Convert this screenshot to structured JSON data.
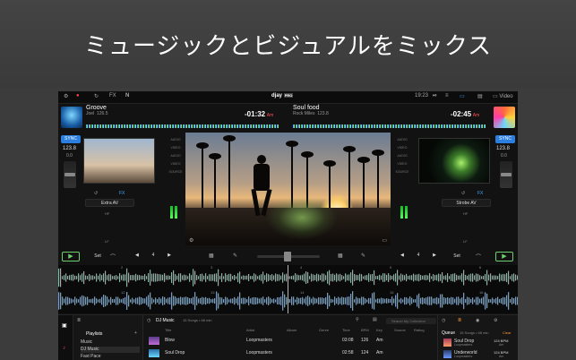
{
  "headline": "ミュージックとビジュアルをミックス",
  "topbar": {
    "fx": "FX",
    "logo": "djay",
    "pro_badge": "PRO",
    "clock": "19:23",
    "video_label": "Video"
  },
  "deck_left": {
    "title": "Groove",
    "artist": "Joel",
    "artist_bpm": "126.5",
    "time": "-01:32",
    "key": "Am",
    "sync": "SYNC",
    "bpm": "123.8",
    "pitch": "0.0",
    "effect": "Extra AV",
    "fx": "FX",
    "label_lf": "LF",
    "label_hf": "HF",
    "set": "Set",
    "beat": "4",
    "play": "▶"
  },
  "deck_right": {
    "title": "Soul food",
    "artist": "Rock Miles",
    "artist_bpm": "123.8",
    "time": "-02:45",
    "key": "Am",
    "sync": "SYNC",
    "bpm": "123.8",
    "pitch": "0.0",
    "effect": "Strobe AV",
    "fx": "FX",
    "label_lf": "LF",
    "label_hf": "HF",
    "set": "Set",
    "beat": "4",
    "play": "▶"
  },
  "mixer": {
    "labels": [
      "AUDIO",
      "VIDEO",
      "AUDIO",
      "VIDEO",
      "SOURCE"
    ]
  },
  "waveforms": {
    "markers_top": [
      "2",
      "3",
      "4",
      "5",
      "6"
    ],
    "markers_bottom": [
      "12",
      "13",
      "14",
      "15",
      "16"
    ]
  },
  "browser": {
    "playlists_title": "Playlists",
    "playlists": [
      "Music",
      "DJ Music",
      "Fast Pace"
    ],
    "active_playlist": "DJ Music",
    "list_title": "DJ Music",
    "list_meta": "15 Songs • 68 min",
    "search_placeholder": "Search My Collection",
    "columns": [
      "Title",
      "Artist",
      "Album",
      "Genre",
      "Time",
      "BPM",
      "Key",
      "Source",
      "Rating"
    ],
    "tracks": [
      {
        "title": "Blow",
        "artist": "Loopmasters",
        "time": "03:08",
        "bpm": "126",
        "key": "Am"
      },
      {
        "title": "Soul Drop",
        "artist": "Loopmasters",
        "time": "02:58",
        "bpm": "124",
        "key": "Am"
      }
    ],
    "queue_title": "Queue",
    "queue_meta": "15 Songs • 68 min",
    "queue_clear": "Clear",
    "queue": [
      {
        "title": "Soul Drop",
        "artist": "Loopmasters",
        "bpm": "124 BPM",
        "key": "Am"
      },
      {
        "title": "Underworld",
        "artist": "Loopmasters",
        "bpm": "124 BPM",
        "key": "Am"
      }
    ]
  }
}
